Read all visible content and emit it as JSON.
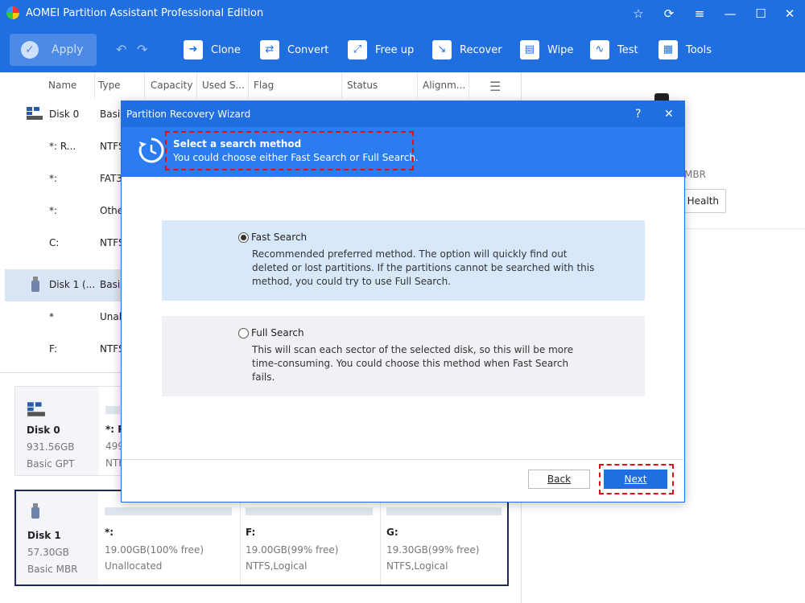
{
  "app": {
    "title": "AOMEI Partition Assistant Professional Edition"
  },
  "toolbar": {
    "apply": "Apply",
    "tools": [
      {
        "label": "Clone",
        "icon": "clone-icon"
      },
      {
        "label": "Convert",
        "icon": "convert-icon"
      },
      {
        "label": "Free up",
        "icon": "free-up-icon"
      },
      {
        "label": "Recover",
        "icon": "recover-icon"
      },
      {
        "label": "Wipe",
        "icon": "wipe-icon"
      },
      {
        "label": "Test",
        "icon": "test-icon"
      },
      {
        "label": "Tools",
        "icon": "tools-icon"
      }
    ]
  },
  "table": {
    "headers": [
      "Name",
      "Type",
      "Capacity",
      "Used S...",
      "Flag",
      "Status",
      "Alignm..."
    ],
    "rows": [
      {
        "name": "Disk 0",
        "type": "Basi"
      },
      {
        "name": "*: R...",
        "type": "NTFS"
      },
      {
        "name": "*:",
        "type": "FAT3"
      },
      {
        "name": "*:",
        "type": "Othe"
      },
      {
        "name": "C:",
        "type": "NTFS"
      },
      {
        "name": "Disk 1 (...",
        "type": "Basi"
      },
      {
        "name": "*",
        "type": "Unal"
      },
      {
        "name": "F:",
        "type": "NTFS"
      }
    ]
  },
  "disks": [
    {
      "name": "Disk 0",
      "size": "931.56GB",
      "style": "Basic GPT",
      "partitions": [
        {
          "name": "*: R",
          "size": "499",
          "fs": "NTF"
        }
      ]
    },
    {
      "name": "Disk 1",
      "size": "57.30GB",
      "style": "Basic MBR",
      "partitions": [
        {
          "name": "*:",
          "size": "19.00GB(100% free)",
          "fs": "Unallocated"
        },
        {
          "name": "F:",
          "size": "19.00GB(99% free)",
          "fs": "NTFS,Logical"
        },
        {
          "name": "G:",
          "size": "19.30GB(99% free)",
          "fs": "NTFS,Logical"
        }
      ]
    }
  ],
  "rightpanel": {
    "mbr": "MBR",
    "health": "Health"
  },
  "dialog": {
    "title": "Partition Recovery Wizard",
    "help": "?",
    "close": "✕",
    "header_title": "Select a search method",
    "header_sub": "You could choose either Fast Search or Full Search.",
    "options": [
      {
        "name": "Fast Search",
        "selected": true,
        "desc": "Recommended preferred method. The option will quickly find out deleted or lost partitions. If the partitions cannot be searched with this method, you could try to use Full Search."
      },
      {
        "name": "Full Search",
        "selected": false,
        "desc": "This will scan each sector of the selected disk, so this will be more time-consuming. You could choose this method when Fast Search fails."
      }
    ],
    "back": "Back",
    "next": "Next"
  },
  "colors": {
    "accent": "#1f6fe0",
    "highlight": "#e01010"
  }
}
